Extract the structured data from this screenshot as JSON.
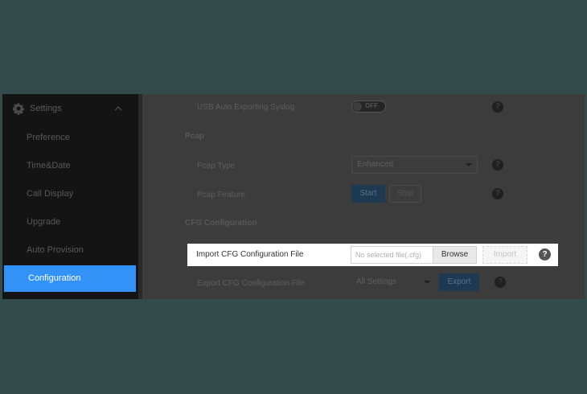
{
  "sidebar": {
    "title": "Settings",
    "items": [
      {
        "label": "Preference"
      },
      {
        "label": "Time&Date"
      },
      {
        "label": "Call Display"
      },
      {
        "label": "Upgrade"
      },
      {
        "label": "Auto Provision"
      },
      {
        "label": "Configuration",
        "active": true
      }
    ]
  },
  "main": {
    "usb_row": {
      "label": "USB Auto Exporting Syslog",
      "toggle_text": "OFF"
    },
    "pcap_section": "Pcap",
    "pcap_type": {
      "label": "Pcap Type",
      "value": "Enhanced"
    },
    "pcap_feature": {
      "label": "Pcap Feature",
      "start_label": "Start",
      "stop_label": "Stop"
    },
    "cfg_section": "CFG Configuration",
    "import_row": {
      "label": "Import CFG Configuration File",
      "file_placeholder": "No selected file(.cfg)",
      "browse_label": "Browse",
      "import_label": "Import"
    },
    "export_row": {
      "label": "Export CFG Configuration File",
      "select_value": "All Settings",
      "export_label": "Export"
    },
    "help_glyph": "?"
  },
  "colors": {
    "accent": "#3292f7",
    "backdrop": "#334b4b"
  }
}
